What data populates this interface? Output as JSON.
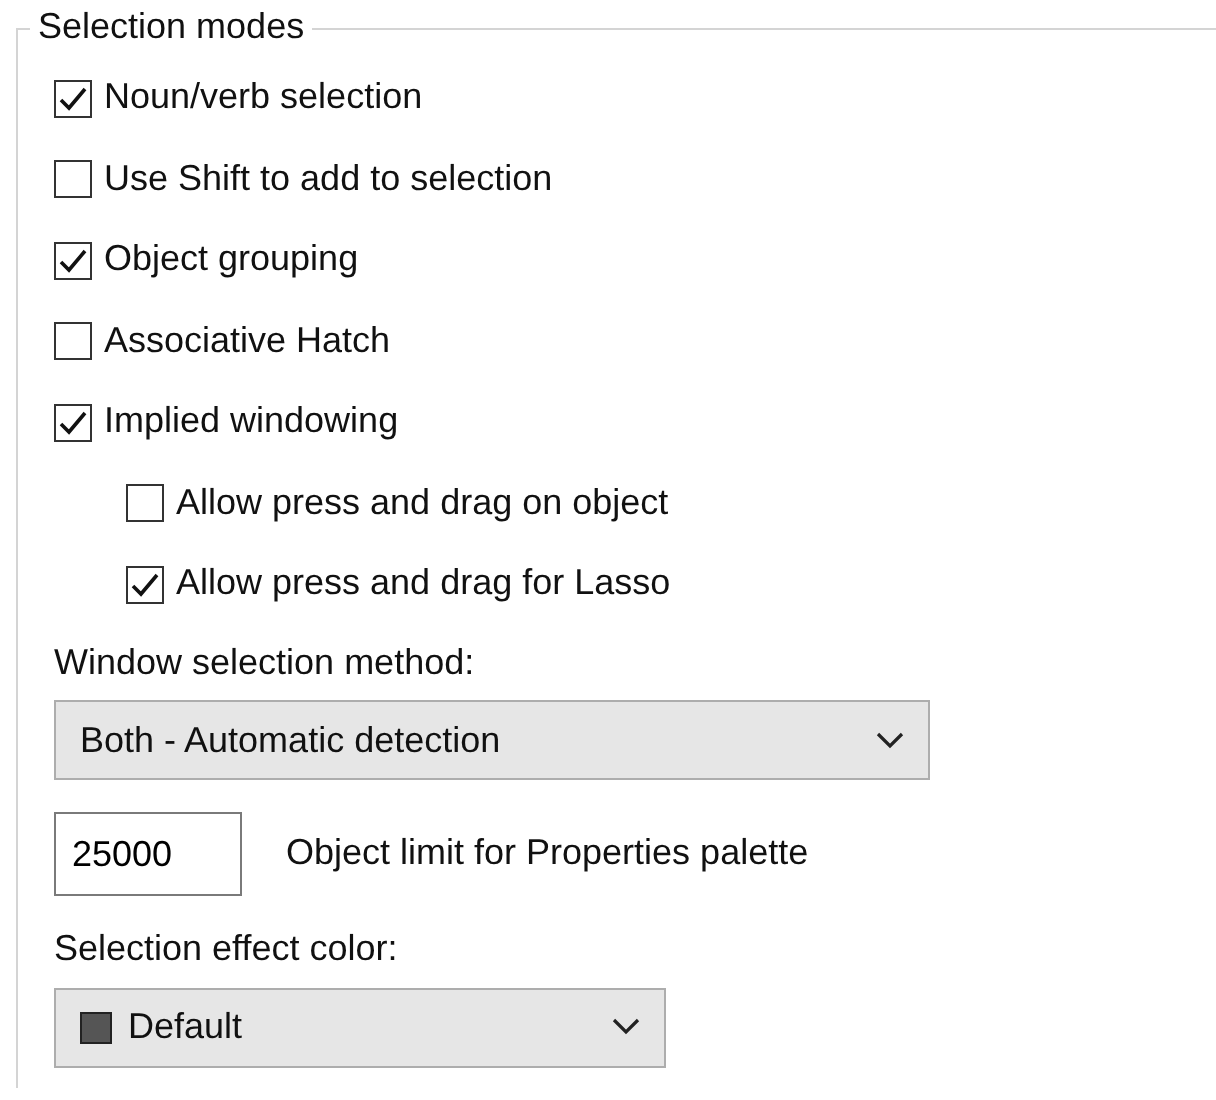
{
  "group": {
    "title": "Selection modes"
  },
  "options": [
    {
      "label": "Noun/verb selection",
      "checked": true
    },
    {
      "label": "Use Shift to add to selection",
      "checked": false
    },
    {
      "label": "Object grouping",
      "checked": true
    },
    {
      "label": "Associative Hatch",
      "checked": false
    },
    {
      "label": "Implied windowing",
      "checked": true,
      "children": [
        {
          "label": "Allow press and drag on object",
          "checked": false
        },
        {
          "label": "Allow press and drag for Lasso",
          "checked": true
        }
      ]
    }
  ],
  "window_selection": {
    "label": "Window selection method:",
    "value": "Both - Automatic detection"
  },
  "object_limit": {
    "value": "25000",
    "label": "Object limit for Properties palette"
  },
  "selection_effect": {
    "label": "Selection effect color:",
    "value": "Default"
  }
}
